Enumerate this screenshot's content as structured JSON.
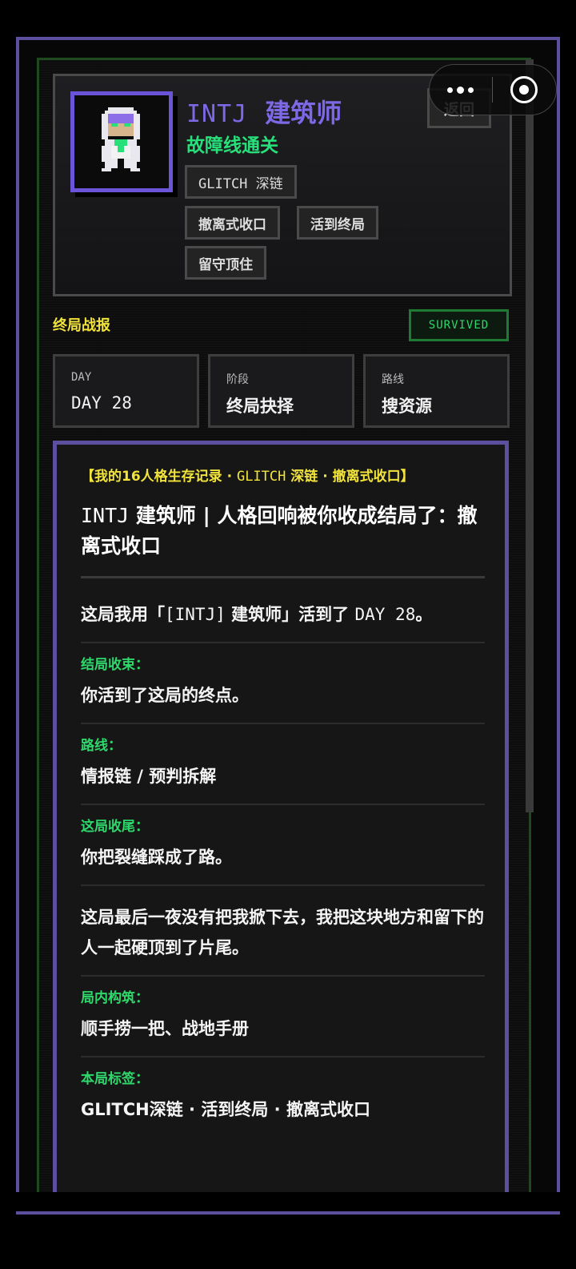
{
  "capsule": {
    "more_icon": "more-dots-icon",
    "close_icon": "target-circle-icon"
  },
  "profile": {
    "code": "INTJ",
    "role": "建筑师",
    "subtitle": "故障线通关",
    "tags": [
      "GLITCH 深链",
      "撤离式收口",
      "活到终局",
      "留守顶住"
    ],
    "back_label": "返回"
  },
  "report_section": {
    "label": "终局战报",
    "status": "SURVIVED"
  },
  "stats": [
    {
      "label": "DAY",
      "value": "DAY 28"
    },
    {
      "label": "阶段",
      "value": "终局抉择"
    },
    {
      "label": "路线",
      "value": "搜资源"
    }
  ],
  "report": {
    "header_part1": "【我的16人格生存记录 · ",
    "header_part2": "GLITCH",
    "header_part3": " 深链 · 撤离式收口】",
    "title_code": "INTJ",
    "title_rest": " 建筑师 | 人格回响被你收成结局了：撤离式收口",
    "intro_part1": "这局我用「",
    "intro_part2": "[INTJ]",
    "intro_part3": " 建筑师」活到了 ",
    "intro_part4": "DAY 28",
    "intro_part5": "。",
    "items": [
      {
        "label": "结局收束：",
        "text": "你活到了这局的终点。"
      },
      {
        "label": "路线：",
        "text": "情报链 / 预判拆解"
      },
      {
        "label": "这局收尾：",
        "text": "你把裂缝踩成了路。"
      }
    ],
    "paragraph": "这局最后一夜没有把我掀下去，我把这块地方和留下的人一起硬顶到了片尾。",
    "build_label": "局内构筑：",
    "build_text": "顺手捞一把、战地手册",
    "tags_label": "本局标签：",
    "tags_text": "GLITCH深链 · 活到终局 · 撤离式收口"
  }
}
